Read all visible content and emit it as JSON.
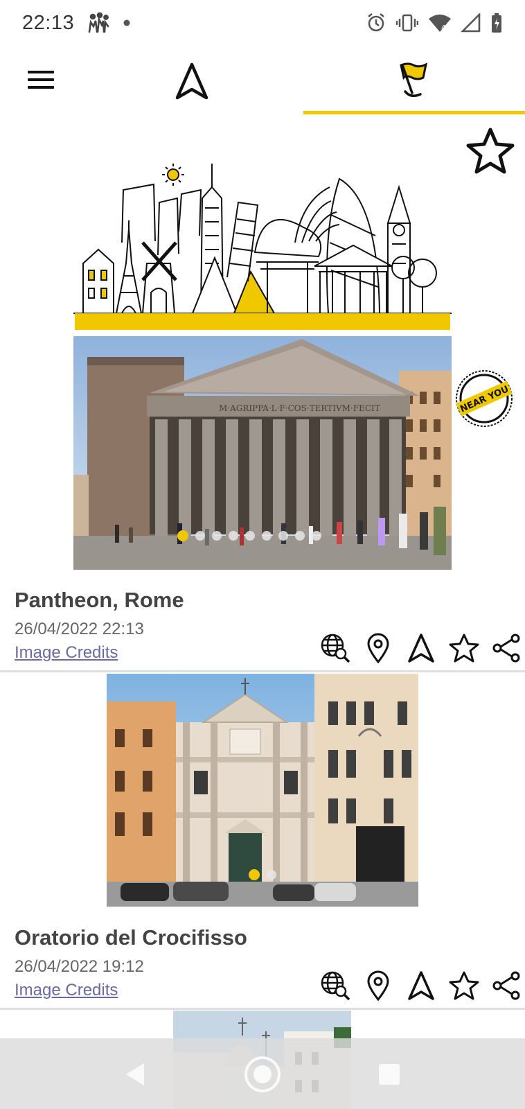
{
  "status_bar": {
    "time": "22:13",
    "icons": [
      "people-icon",
      "notification-dot-icon",
      "alarm-icon",
      "vibrate-icon",
      "wifi-icon",
      "signal-icon",
      "battery-icon"
    ]
  },
  "app_bar": {
    "tabs": [
      "navigation-arrow-icon",
      "flag-pin-icon"
    ],
    "active_tab": "flag-pin-icon",
    "accent_color": "#f0c800"
  },
  "hero": {
    "favorite_icon": "star-outline-icon"
  },
  "cards": [
    {
      "title": "Pantheon, Rome",
      "date": "26/04/2022 22:13",
      "credits": "Image Credits",
      "badge": "NEAR YOU",
      "photo_dots": 9,
      "active_dot": 0
    },
    {
      "title": "Oratorio del Crocifisso",
      "date": "26/04/2022 19:12",
      "credits": "Image Credits",
      "photo_dots": 2,
      "active_dot": 0
    }
  ],
  "card_actions": [
    "globe-search-icon",
    "location-pin-icon",
    "navigation-arrow-icon",
    "star-outline-icon",
    "share-icon"
  ],
  "nav_bar": [
    "back-icon",
    "home-icon",
    "recents-icon"
  ]
}
